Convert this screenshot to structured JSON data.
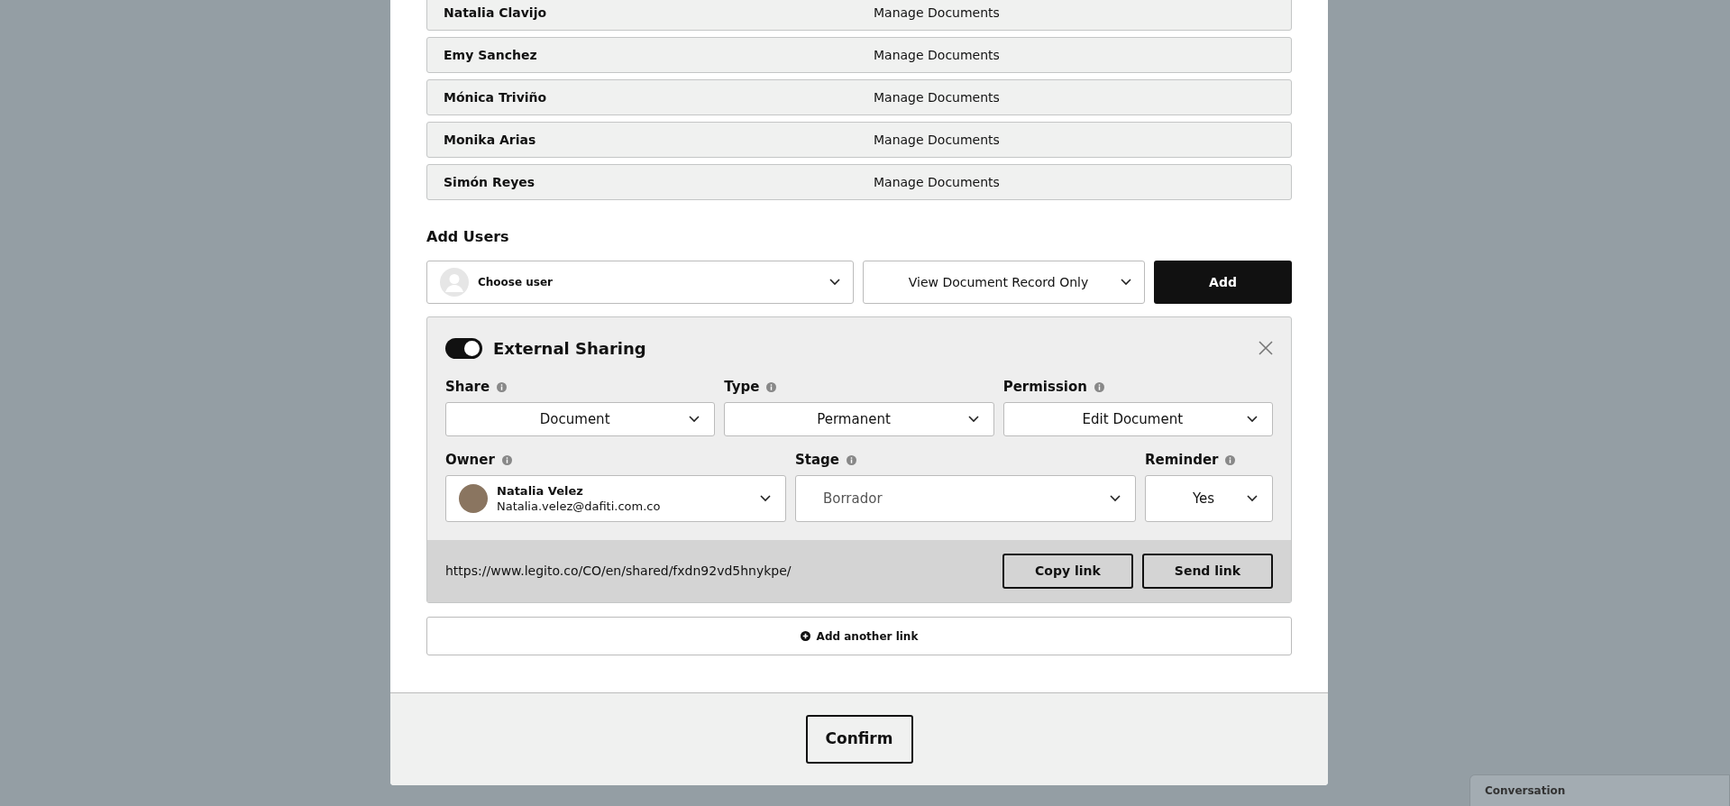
{
  "members": [
    {
      "name": "Natalia Clavijo",
      "role": "Manage Documents"
    },
    {
      "name": "Emy Sanchez",
      "role": "Manage Documents"
    },
    {
      "name": "Mónica Triviño",
      "role": "Manage Documents"
    },
    {
      "name": "Monika Arias",
      "role": "Manage Documents"
    },
    {
      "name": "Simón Reyes",
      "role": "Manage Documents"
    }
  ],
  "add_users": {
    "title": "Add Users",
    "user_select": {
      "placeholder": "Choose user"
    },
    "permission_select": {
      "value": "View Document Record Only"
    },
    "add_button": "Add"
  },
  "external_sharing": {
    "on": true,
    "title": "External Sharing",
    "fields": [
      {
        "label": "Share",
        "value": "Document",
        "kind": "select"
      },
      {
        "label": "Type",
        "value": "Permanent",
        "kind": "select"
      },
      {
        "label": "Permission",
        "value": "Edit Document",
        "kind": "select"
      },
      {
        "label": "Owner",
        "kind": "person",
        "name": "Natalia Velez",
        "email": "Natalia.velez@dafiti.com.co"
      },
      {
        "label": "Stage",
        "value": "Borrador",
        "kind": "muted"
      },
      {
        "label": "Reminder",
        "value": "Yes",
        "kind": "select"
      }
    ],
    "link": "https://www.legito.co/CO/en/shared/fxdn92vd5hnykpe/",
    "copy_button": "Copy link",
    "send_button": "Send link"
  },
  "add_link_button": "Add another link",
  "confirm_button": "Confirm",
  "chat_tab": "Conversation"
}
